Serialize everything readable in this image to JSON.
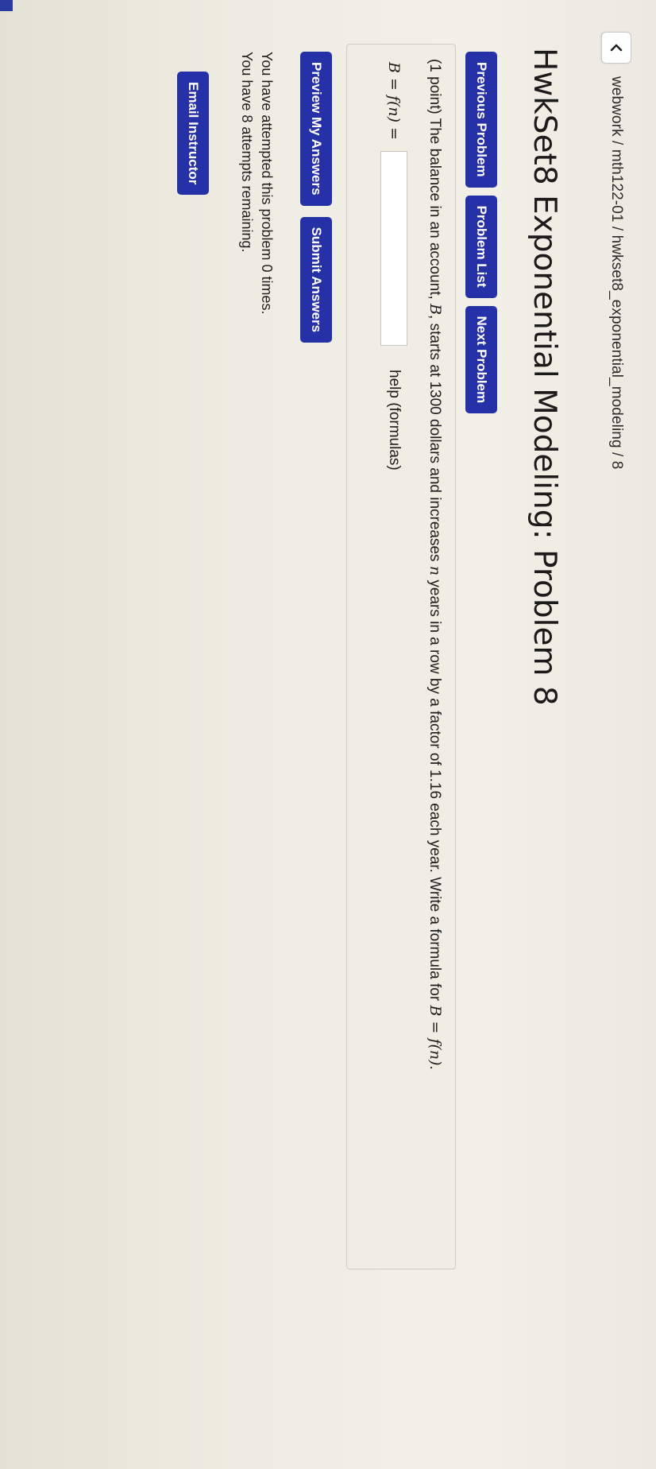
{
  "nav": {
    "back_icon": "chevron-left-icon",
    "breadcrumb": "webwork / mth122-01 / hwkset8_exponential_modeling / 8"
  },
  "page_title": "HwkSet8 Exponential Modeling: Problem 8",
  "buttons": {
    "previous": "Previous Problem",
    "list": "Problem List",
    "next": "Next Problem",
    "preview": "Preview My Answers",
    "submit": "Submit Answers",
    "email": "Email Instructor"
  },
  "problem": {
    "text_1": "(1 point) The balance in an account, ",
    "var_B": "B",
    "text_2": ", starts at 1300 dollars and increases ",
    "var_n": "n",
    "text_3": " years in a row by a factor of 1.16 each year. Write a formula for ",
    "formula": "B = f(n)",
    "text_4": ".",
    "answer_prefix": "B = f(n) =",
    "answer_value": "",
    "help_link": "help (formulas)"
  },
  "status": {
    "attempted": "You have attempted this problem 0 times.",
    "remaining": "You have 8 attempts remaining."
  },
  "colors": {
    "button_bg": "#2631a8",
    "button_text": "#ffffff",
    "page_bg": "#efede3"
  }
}
